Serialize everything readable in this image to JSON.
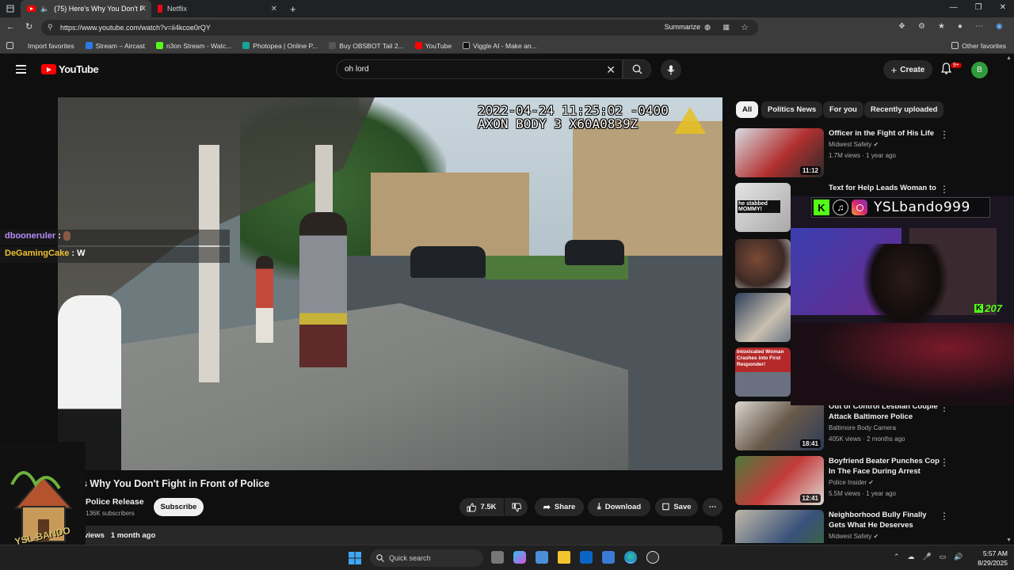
{
  "browser": {
    "tabs": [
      {
        "label": "(75) Here's Why You Don't F"
      },
      {
        "label": "Netflix"
      }
    ],
    "url": "https://www.youtube.com/watch?v=ii4kcoe0rQY",
    "summarize_label": "Summarize",
    "bookmarks": [
      {
        "label": "Import favorites"
      },
      {
        "label": "Stream – Aircast"
      },
      {
        "label": "n3on Stream - Watc..."
      },
      {
        "label": "Photopea | Online P..."
      },
      {
        "label": "Buy OBSBOT Tail 2..."
      },
      {
        "label": "YouTube"
      },
      {
        "label": "Viggle AI - Make an..."
      }
    ],
    "other_favorites": "Other favorites"
  },
  "youtube": {
    "logo_text": "YouTube",
    "search_value": "oh lord",
    "create_label": "Create",
    "notif_badge": "9+",
    "avatar_letter": "B"
  },
  "video": {
    "timestamp_line1": "2022-04-24 11:25:02 -0400",
    "timestamp_line2": "AXON BODY 3 X60A0839Z",
    "title": "s Why You Don't Fight in Front of Police",
    "channel": "Police Release",
    "subscribers": "136K subscribers",
    "subscribe_label": "Subscribe",
    "likes": "7.5K",
    "share_label": "Share",
    "download_label": "Download",
    "save_label": "Save",
    "desc_views": "views",
    "desc_date": "1 month ago"
  },
  "chips": [
    {
      "label": "All",
      "active": true
    },
    {
      "label": "Politics News"
    },
    {
      "label": "For you"
    },
    {
      "label": "Recently uploaded"
    }
  ],
  "recommendations": [
    {
      "title": "Officer in the Fight of His Life",
      "channel": "Midwest Safety",
      "meta": "1.7M views · 1 year ago",
      "duration": "11:12"
    },
    {
      "title": "Text for Help Leads Woman to",
      "channel": "",
      "meta": "",
      "duration": "",
      "thumb_text": "he stabbed MOMMY!"
    },
    {
      "title": "",
      "channel": "",
      "meta": "",
      "duration": ""
    },
    {
      "title": "",
      "channel": "",
      "meta": "",
      "duration": ""
    },
    {
      "title": "",
      "channel": "",
      "meta": "",
      "duration": "",
      "thumb_text": "Intoxicated Woman Crashes into First Responder!"
    },
    {
      "title": "Out of Control Lesbian Couple Attack Baltimore Police",
      "channel": "Baltimore Body Camera",
      "meta": "405K views · 2 months ago",
      "duration": "18:41"
    },
    {
      "title": "Boyfriend Beater Punches Cop In The Face During Arrest",
      "channel": "Police Insider",
      "meta": "5.5M views · 1 year ago",
      "duration": "12:41"
    },
    {
      "title": "Neighborhood Bully Finally Gets What He Deserves",
      "channel": "Midwest Safety",
      "meta": "",
      "duration": ""
    }
  ],
  "overlay": {
    "social_handle": "YSLbando999",
    "kick_count": "207",
    "chat": [
      {
        "user": "dbooneruler",
        "message": ""
      },
      {
        "user": "DeGamingCake",
        "message": "W"
      }
    ],
    "logo_text": "YSL-BANDO"
  },
  "taskbar": {
    "search_placeholder": "Quick search",
    "time": "5:57 AM",
    "date": "8/29/2025"
  }
}
